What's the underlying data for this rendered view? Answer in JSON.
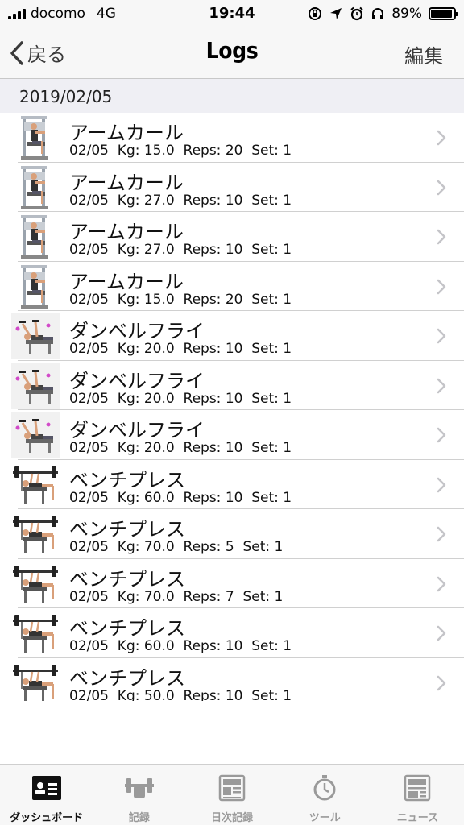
{
  "status_bar": {
    "carrier": "docomo",
    "network": "4G",
    "time": "19:44",
    "battery": "89%"
  },
  "nav": {
    "back_label": "戻る",
    "title": "Logs",
    "edit_label": "編集"
  },
  "section": {
    "date": "2019/02/05"
  },
  "rows": [
    {
      "title": "アームカール",
      "detail": "02/05  Kg: 15.0  Reps: 20  Set: 1",
      "icon": "arm-curl-machine-icon"
    },
    {
      "title": "アームカール",
      "detail": "02/05  Kg: 27.0  Reps: 10  Set: 1",
      "icon": "arm-curl-machine-icon"
    },
    {
      "title": "アームカール",
      "detail": "02/05  Kg: 27.0  Reps: 10  Set: 1",
      "icon": "arm-curl-machine-icon"
    },
    {
      "title": "アームカール",
      "detail": "02/05  Kg: 15.0  Reps: 20  Set: 1",
      "icon": "arm-curl-machine-icon"
    },
    {
      "title": "ダンベルフライ",
      "detail": "02/05  Kg: 20.0  Reps: 10  Set: 1",
      "icon": "dumbbell-fly-icon"
    },
    {
      "title": "ダンベルフライ",
      "detail": "02/05  Kg: 20.0  Reps: 10  Set: 1",
      "icon": "dumbbell-fly-icon"
    },
    {
      "title": "ダンベルフライ",
      "detail": "02/05  Kg: 20.0  Reps: 10  Set: 1",
      "icon": "dumbbell-fly-icon"
    },
    {
      "title": "ベンチプレス",
      "detail": "02/05  Kg: 60.0  Reps: 10  Set: 1",
      "icon": "bench-press-icon"
    },
    {
      "title": "ベンチプレス",
      "detail": "02/05  Kg: 70.0  Reps: 5  Set: 1",
      "icon": "bench-press-icon"
    },
    {
      "title": "ベンチプレス",
      "detail": "02/05  Kg: 70.0  Reps: 7  Set: 1",
      "icon": "bench-press-icon"
    },
    {
      "title": "ベンチプレス",
      "detail": "02/05  Kg: 60.0  Reps: 10  Set: 1",
      "icon": "bench-press-icon"
    },
    {
      "title": "ベンチプレス",
      "detail": "02/05  Kg: 50.0  Reps: 10  Set: 1",
      "icon": "bench-press-icon"
    }
  ],
  "tabs": [
    {
      "label": "ダッシュボード",
      "icon": "dashboard-card-icon",
      "active": true
    },
    {
      "label": "記録",
      "icon": "barbell-record-icon",
      "active": false
    },
    {
      "label": "日次記録",
      "icon": "daily-log-icon",
      "active": false
    },
    {
      "label": "ツール",
      "icon": "stopwatch-icon",
      "active": false
    },
    {
      "label": "ニュース",
      "icon": "news-icon",
      "active": false
    }
  ],
  "colors": {
    "bar_background": "#f7f7f7",
    "section_background": "#efeff4",
    "tab_active": "#111111",
    "tab_inactive": "#9a9a9a"
  }
}
